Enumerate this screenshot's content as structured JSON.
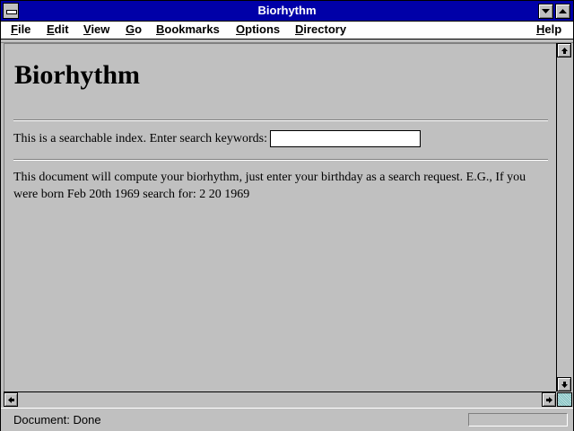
{
  "window": {
    "title": "Biorhythm"
  },
  "menu": {
    "items": [
      {
        "label": "File"
      },
      {
        "label": "Edit"
      },
      {
        "label": "View"
      },
      {
        "label": "Go"
      },
      {
        "label": "Bookmarks"
      },
      {
        "label": "Options"
      },
      {
        "label": "Directory"
      },
      {
        "label": "Help"
      }
    ]
  },
  "page": {
    "heading": "Biorhythm",
    "search_prompt": "This is a searchable index. Enter search keywords:",
    "search_value": "",
    "description": "This document will compute your biorhythm, just enter your birthday as a search request. E.G., If you were born Feb 20th 1969 search for: 2 20 1969"
  },
  "status": {
    "text": "Document: Done"
  },
  "icons": {
    "system_menu": "system-menu-icon",
    "minimize": "minimize-icon",
    "maximize": "maximize-icon",
    "scroll_up": "arrow-up-icon",
    "scroll_down": "arrow-down-icon",
    "scroll_left": "arrow-left-icon",
    "scroll_right": "arrow-right-icon"
  },
  "colors": {
    "title_bar": "#0000a8",
    "window_bg": "#c0c0c0",
    "input_bg": "#ffffff"
  }
}
